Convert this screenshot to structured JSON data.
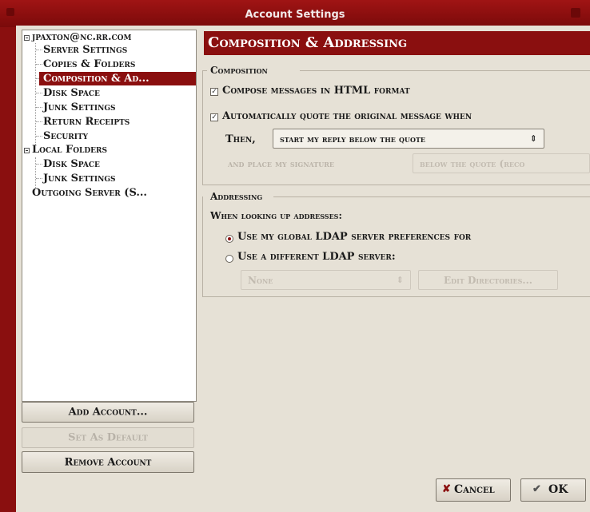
{
  "window": {
    "title": "Account Settings"
  },
  "tree": {
    "items": [
      {
        "label": "jpaxton@nc.rr.com",
        "level": 0,
        "expanded": true
      },
      {
        "label": "Server Settings",
        "level": 1
      },
      {
        "label": "Copies & Folders",
        "level": 1
      },
      {
        "label": "Composition & Ad...",
        "level": 1,
        "selected": true
      },
      {
        "label": "Disk Space",
        "level": 1
      },
      {
        "label": "Junk Settings",
        "level": 1
      },
      {
        "label": "Return Receipts",
        "level": 1
      },
      {
        "label": "Security",
        "level": 1
      },
      {
        "label": "Local Folders",
        "level": 0,
        "expanded": true
      },
      {
        "label": "Disk Space",
        "level": 1
      },
      {
        "label": "Junk Settings",
        "level": 1
      },
      {
        "label": "Outgoing Server (S...",
        "level": 0
      }
    ]
  },
  "account_buttons": {
    "add": "Add Account...",
    "set_default": "Set As Default",
    "remove": "Remove Account"
  },
  "panel": {
    "title": "Composition & Addressing",
    "composition": {
      "label": "Composition",
      "html_format": {
        "label": "Compose messages in HTML format",
        "checked": true
      },
      "quote": {
        "label": "Automatically quote the original message when",
        "checked": true
      },
      "then_label": "Then,",
      "reply_select": "start my reply below the quote",
      "signature_label": "and place my signature",
      "signature_select": "below the quote (reco"
    },
    "addressing": {
      "label": "Addressing",
      "lookup_label": "When looking up addresses:",
      "global_ldap": {
        "label": "Use my global LDAP server preferences for",
        "selected": true
      },
      "different_ldap": {
        "label": "Use a different LDAP server:",
        "selected": false
      },
      "server_select": "None",
      "edit_directories": "Edit Directories..."
    }
  },
  "dialog_buttons": {
    "cancel": "Cancel",
    "ok": "OK"
  },
  "colors": {
    "accent": "#8a0f0f",
    "background": "#e6e1d6"
  }
}
